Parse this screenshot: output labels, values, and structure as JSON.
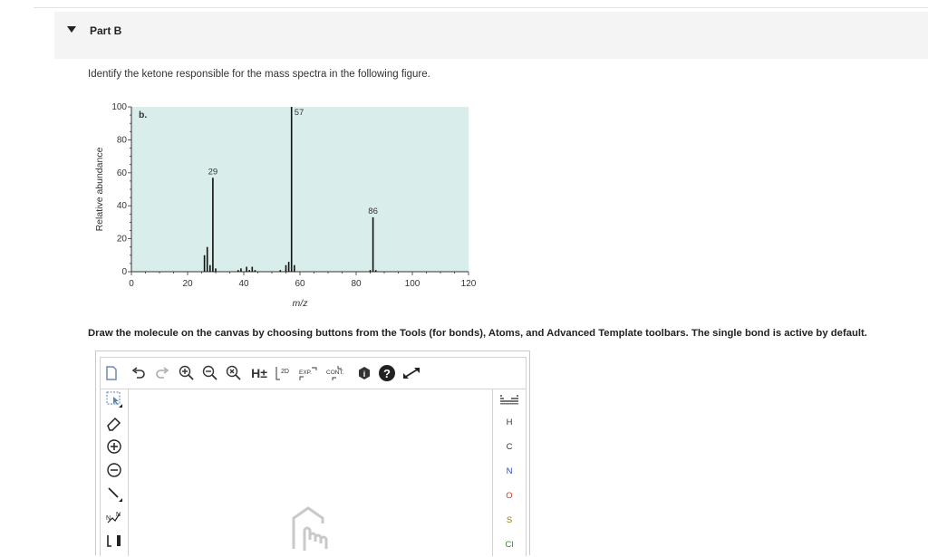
{
  "part": {
    "title": "Part B"
  },
  "question": "Identify the ketone responsible for the mass spectra in the following figure.",
  "chart_data": {
    "type": "bar",
    "panel_label": "b.",
    "xlabel": "m/z",
    "ylabel": "Relative abundance",
    "xlim": [
      0,
      120
    ],
    "ylim": [
      0,
      100
    ],
    "xticks": [
      0,
      20,
      40,
      60,
      80,
      100,
      120
    ],
    "yticks": [
      0,
      20,
      40,
      60,
      80,
      100
    ],
    "x": [
      26,
      27,
      28,
      29,
      30,
      38,
      39,
      41,
      42,
      43,
      44,
      53,
      55,
      56,
      57,
      58,
      85,
      86,
      87
    ],
    "values": [
      10,
      15,
      4,
      57,
      2,
      1,
      2,
      3,
      1,
      3,
      1,
      1,
      4,
      6,
      100,
      4,
      1,
      33,
      1
    ],
    "peak_labels": [
      {
        "x": 29,
        "label": "29"
      },
      {
        "x": 57,
        "label": "57"
      },
      {
        "x": 86,
        "label": "86"
      }
    ],
    "background": "#d9eeea"
  },
  "instructions": "Draw the molecule on the canvas by choosing buttons from the Tools (for bonds), Atoms, and Advanced Template toolbars. The single bond is active by default.",
  "editor": {
    "top_tools": [
      {
        "name": "new-document-icon"
      },
      {
        "name": "undo-icon"
      },
      {
        "name": "redo-icon"
      },
      {
        "name": "zoom-in-icon"
      },
      {
        "name": "zoom-out-icon"
      },
      {
        "name": "zoom-reset-icon"
      },
      {
        "name": "hydrogen-toggle",
        "label": "H±"
      },
      {
        "name": "2d-clean-button",
        "label": "2D"
      },
      {
        "name": "expand-button",
        "label": "EXP."
      },
      {
        "name": "contract-button",
        "label": "CONT."
      },
      {
        "name": "info-icon"
      },
      {
        "name": "help-icon"
      },
      {
        "name": "fullscreen-icon"
      }
    ],
    "atoms": [
      "H",
      "C",
      "N",
      "O",
      "S",
      "Cl"
    ],
    "atom_colors": {
      "H": "#333333",
      "C": "#333333",
      "N": "#2a47c9",
      "O": "#d43a2a",
      "S": "#8a7a18",
      "Cl": "#2e8a2e"
    },
    "charge_label": "N"
  }
}
